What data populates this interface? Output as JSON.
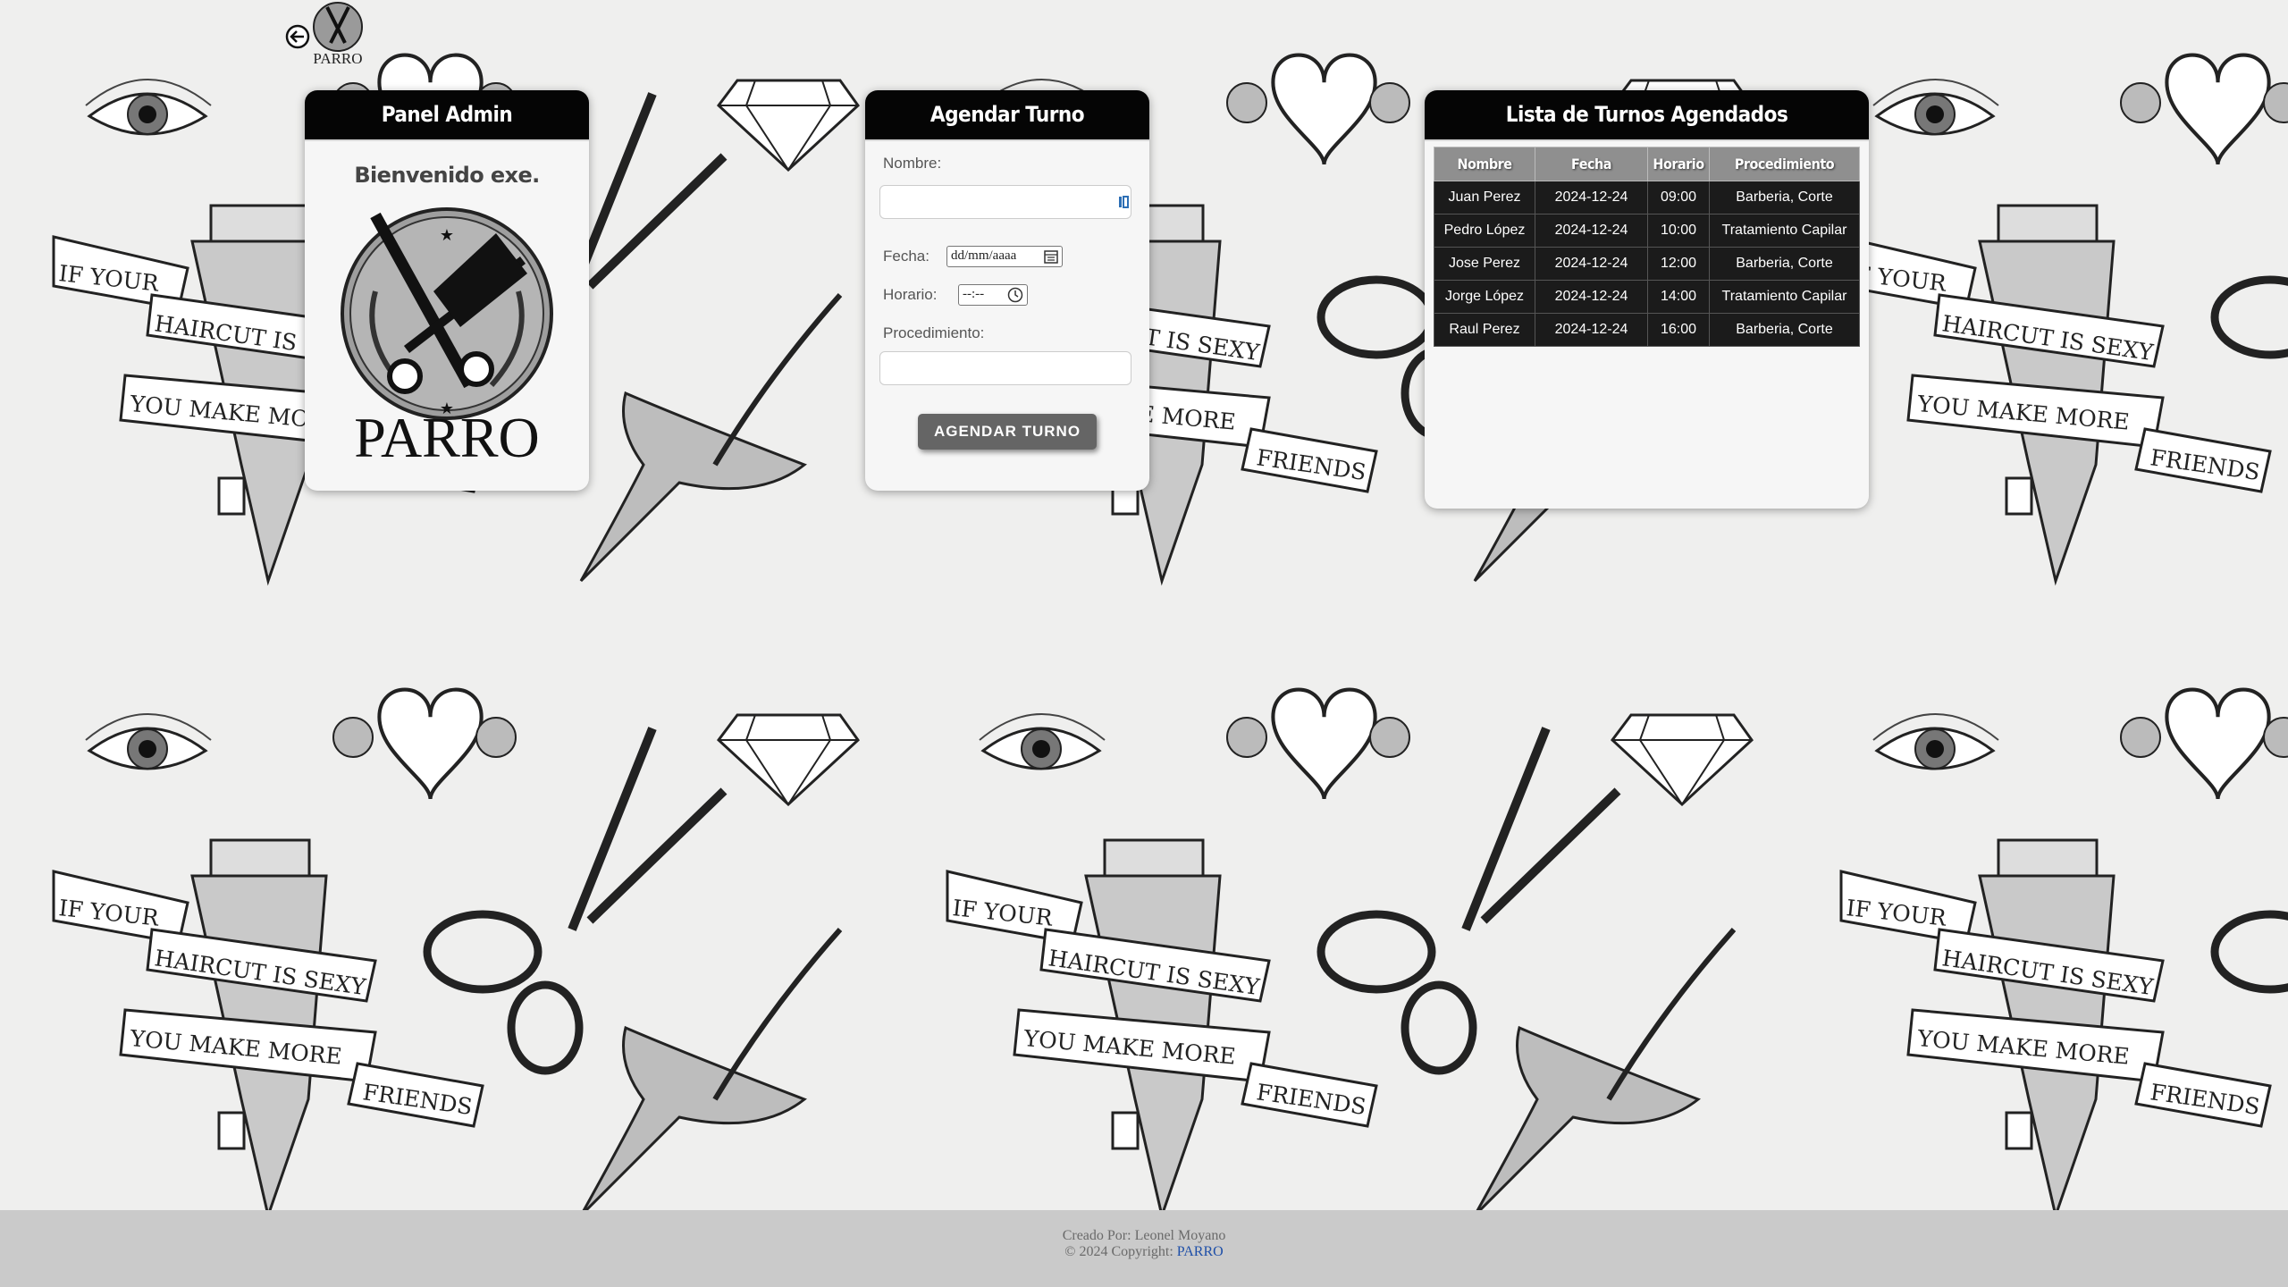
{
  "nav": {
    "logo_text": "PARRO"
  },
  "admin_panel": {
    "title": "Panel Admin",
    "welcome": "Bienvenido exe.",
    "logo_text": "PARRO"
  },
  "form": {
    "title": "Agendar Turno",
    "nombre_label": "Nombre:",
    "fecha_label": "Fecha:",
    "fecha_placeholder": "dd/mm/aaaa",
    "horario_label": "Horario:",
    "horario_placeholder": "--:--",
    "procedimiento_label": "Procedimiento:",
    "submit_label": "AGENDAR TURNO"
  },
  "turnos": {
    "title": "Lista de Turnos Agendados",
    "columns": [
      "Nombre",
      "Fecha",
      "Horario",
      "Procedimiento"
    ],
    "rows": [
      [
        "Juan Perez",
        "2024-12-24",
        "09:00",
        "Barberia, Corte"
      ],
      [
        "Pedro López",
        "2024-12-24",
        "10:00",
        "Tratamiento Capilar"
      ],
      [
        "Jose Perez",
        "2024-12-24",
        "12:00",
        "Barberia, Corte"
      ],
      [
        "Jorge López",
        "2024-12-24",
        "14:00",
        "Tratamiento Capilar"
      ],
      [
        "Raul Perez",
        "2024-12-24",
        "16:00",
        "Barberia, Corte"
      ]
    ]
  },
  "background": {
    "banner_line1": "IF YOUR",
    "banner_line2": "HAIRCUT IS SEXY",
    "banner_line3": "YOU MAKE MORE",
    "banner_line4": "FRIENDS"
  },
  "footer": {
    "created_by": "Creado Por: Leonel Moyano",
    "copyright": "© 2024 Copyright: ",
    "link_text": "PARRO"
  }
}
